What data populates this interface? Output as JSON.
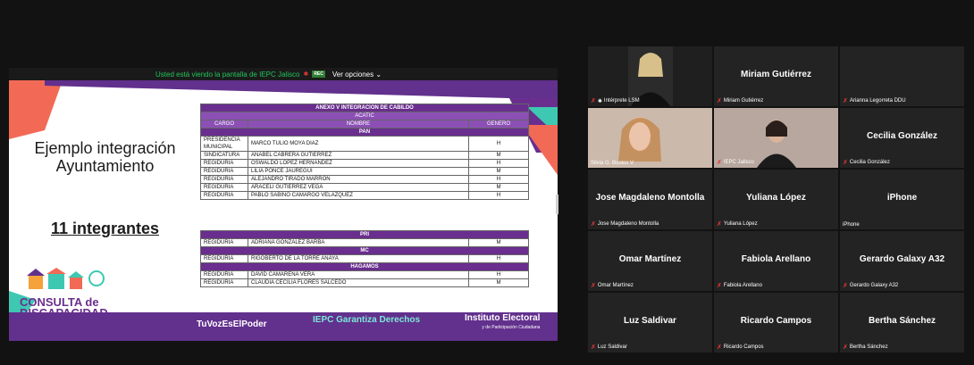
{
  "share_banner": {
    "text": "Usted está viendo la pantalla de IEPC Jalisco",
    "rec": "REC",
    "options": "Ver opciones ⌄"
  },
  "slide": {
    "title": "Ejemplo integración Ayuntamiento",
    "subtitle": "11 integrantes",
    "logo_text": "CONSULTA de DISCAPACIDAD",
    "footer_hashtag": "TuVozEsElPoder",
    "footer_iepc": "IEPC Garantiza Derechos",
    "footer_institute": "Instituto Electoral",
    "footer_institute_sub": "y de Participación Ciudadana"
  },
  "table1": {
    "title": "ANEXO V INTEGRACION DE CABILDO",
    "municipality": "ACATIC",
    "headers": [
      "CARGO",
      "NOMBRE",
      "GENERO"
    ],
    "party": "PAN",
    "rows": [
      [
        "PRESIDENCIA MUNICIPAL",
        "MARCO TULIO MOYA DIAZ",
        "H"
      ],
      [
        "SINDICATURA",
        "ANABEL CABRERA GUTIERREZ",
        "M"
      ],
      [
        "REGIDURIA",
        "OSWALDO LOPEZ HERNANDEZ",
        "H"
      ],
      [
        "REGIDURIA",
        "LILIA PONCE JAUREGUI",
        "M"
      ],
      [
        "REGIDURIA",
        "ALEJANDRO TIRADO MARRON",
        "H"
      ],
      [
        "REGIDURIA",
        "ARACELI GUTIERREZ VEGA",
        "M"
      ],
      [
        "REGIDURIA",
        "PABLO SABINO CAMARGO VELAZQUEZ",
        "H"
      ]
    ]
  },
  "table2": {
    "groups": [
      {
        "party": "PRI",
        "rows": [
          [
            "REGIDURIA",
            "ADRIANA GONZALEZ BARBA",
            "M"
          ]
        ]
      },
      {
        "party": "MC",
        "rows": [
          [
            "REGIDURIA",
            "RIGOBERTO DE LA TORRE ANAYA",
            "H"
          ]
        ]
      },
      {
        "party": "HAGAMOS",
        "rows": [
          [
            "REGIDURIA",
            "DAVID CAMARENA VERA",
            "H"
          ],
          [
            "REGIDURIA",
            "CLAUDIA CECILIA FLORES SALCEDO",
            "M"
          ]
        ]
      }
    ]
  },
  "participants": [
    {
      "label": "Intérprete LSM",
      "big": "",
      "video": true,
      "active": true,
      "pinned": true
    },
    {
      "label": "Miriam Gutiérrez",
      "big": "Miriam Gutiérrez",
      "video": false
    },
    {
      "label": "Arianna Legorreta DDU",
      "big": "",
      "video": false
    },
    {
      "label": "Silvia G. Bustos V",
      "big": "",
      "video": true,
      "nomic": true
    },
    {
      "label": "IEPC Jalisco",
      "big": "",
      "video": true
    },
    {
      "label": "Cecilia González",
      "big": "Cecilia González",
      "video": false
    },
    {
      "label": "Jose Magdaleno Montolla",
      "big": "Jose Magdaleno Montolla",
      "video": false
    },
    {
      "label": "Yuliana López",
      "big": "Yuliana López",
      "video": false
    },
    {
      "label": "iPhone",
      "big": "iPhone",
      "video": false,
      "nomic": true
    },
    {
      "label": "Omar Martínez",
      "big": "Omar Martínez",
      "video": false
    },
    {
      "label": "Fabiola Arellano",
      "big": "Fabiola Arellano",
      "video": false
    },
    {
      "label": "Gerardo Galaxy A32",
      "big": "Gerardo Galaxy A32",
      "video": false
    },
    {
      "label": "Luz Saldivar",
      "big": "Luz Saldivar",
      "video": false
    },
    {
      "label": "Ricardo Campos",
      "big": "Ricardo Campos",
      "video": false
    },
    {
      "label": "Bertha Sánchez",
      "big": "Bertha Sánchez",
      "video": false
    }
  ]
}
